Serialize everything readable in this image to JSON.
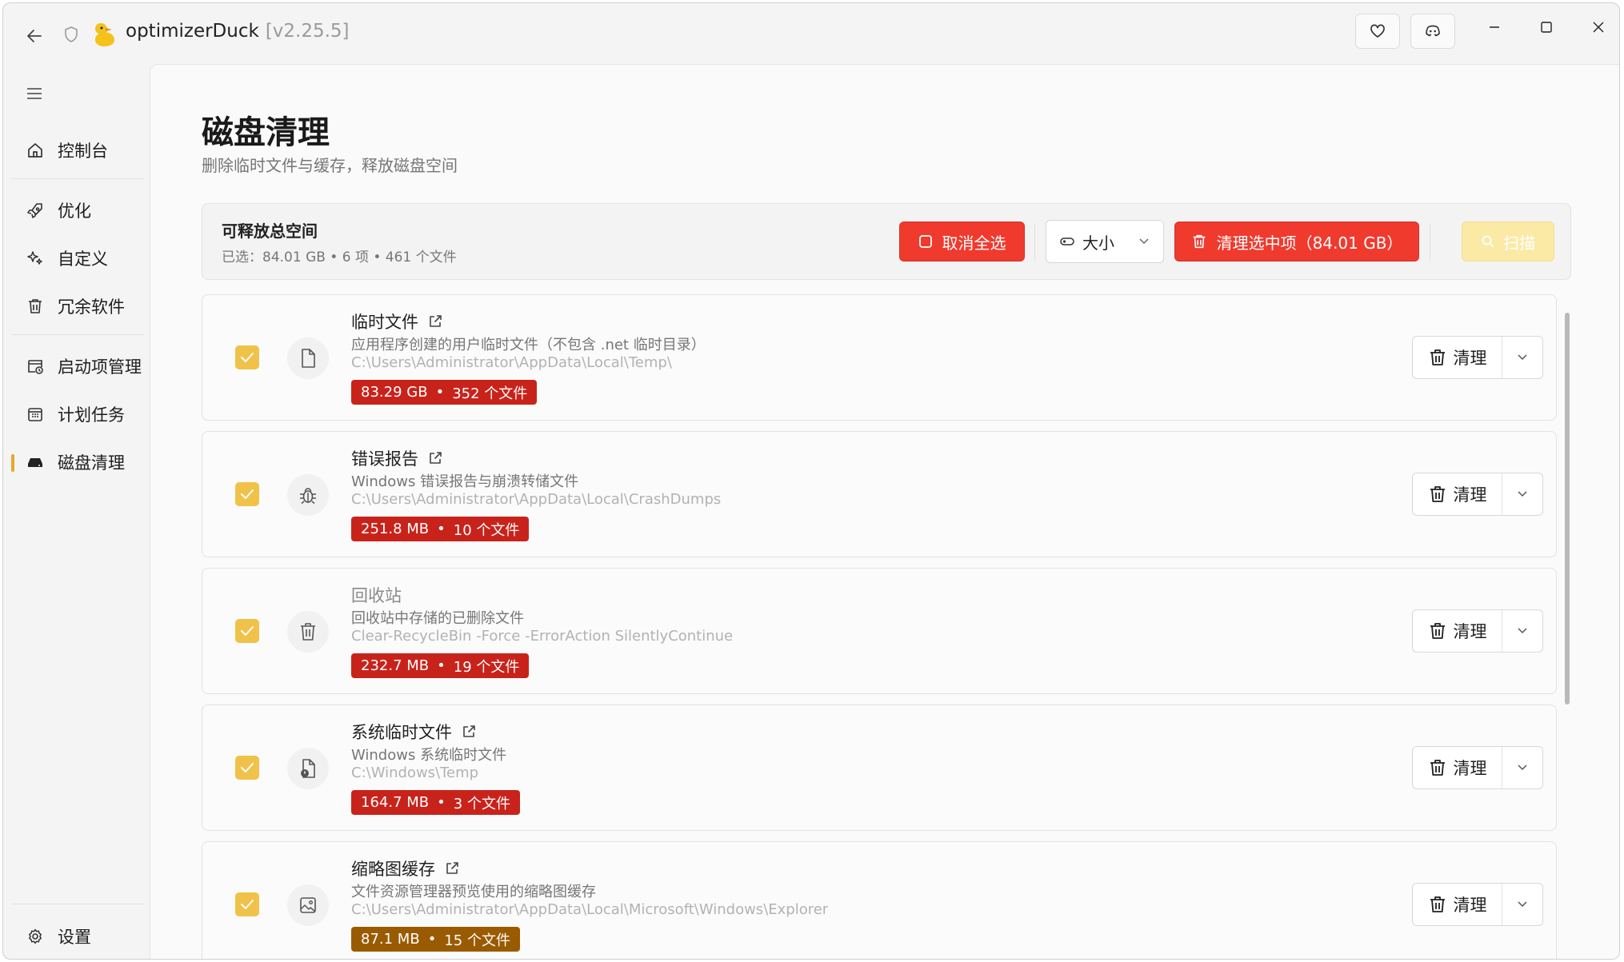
{
  "app": {
    "name": "optimizerDuck",
    "version": "[v2.25.5]"
  },
  "titlebar_icons": {
    "back": "arrow-left-icon",
    "shield": "shield-icon",
    "logo": "duck-logo",
    "favorite": "heart-icon",
    "community": "discord-icon",
    "minimize": "minimize-icon",
    "maximize": "maximize-icon",
    "close": "close-icon"
  },
  "sidebar": {
    "items": [
      {
        "label": "控制台",
        "icon": "home-icon"
      },
      {
        "label": "优化",
        "icon": "rocket-icon"
      },
      {
        "label": "自定义",
        "icon": "sparkle-icon"
      },
      {
        "label": "冗余软件",
        "icon": "trash-icon"
      },
      {
        "label": "启动项管理",
        "icon": "startup-icon"
      },
      {
        "label": "计划任务",
        "icon": "calendar-icon"
      },
      {
        "label": "磁盘清理",
        "icon": "drive-icon",
        "active": true
      }
    ],
    "settings": {
      "label": "设置",
      "icon": "gear-icon"
    }
  },
  "page": {
    "title": "磁盘清理",
    "subtitle": "删除临时文件与缓存，释放磁盘空间"
  },
  "summary": {
    "title": "可释放总空间",
    "detail": "已选：84.01 GB • 6 项 • 461 个文件",
    "deselect_label": "取消全选",
    "sort_label": "大小",
    "clean_selected_label": "清理选中项（84.01 GB）",
    "scan_label": "扫描"
  },
  "items": [
    {
      "title": "临时文件",
      "desc": "应用程序创建的用户临时文件（不包含 .net 临时目录）",
      "path": "C:\\Users\\Administrator\\AppData\\Local\\Temp\\",
      "size": "83.29 GB",
      "files": "352 个文件",
      "icon": "file-icon",
      "external": true,
      "clean_label": "清理"
    },
    {
      "title": "错误报告",
      "desc": "Windows 错误报告与崩溃转储文件",
      "path": "C:\\Users\\Administrator\\AppData\\Local\\CrashDumps",
      "size": "251.8 MB",
      "files": "10 个文件",
      "icon": "bug-icon",
      "external": true,
      "clean_label": "清理"
    },
    {
      "title": "回收站",
      "desc": "回收站中存储的已删除文件",
      "path": "Clear-RecycleBin -Force -ErrorAction SilentlyContinue",
      "size": "232.7 MB",
      "files": "19 个文件",
      "icon": "recycle-bin-icon",
      "external": false,
      "clean_label": "清理"
    },
    {
      "title": "系统临时文件",
      "desc": "Windows 系统临时文件",
      "path": "C:\\Windows\\Temp",
      "size": "164.7 MB",
      "files": "3 个文件",
      "icon": "system-file-icon",
      "external": true,
      "clean_label": "清理"
    },
    {
      "title": "缩略图缓存",
      "desc": "文件资源管理器预览使用的缩略图缓存",
      "path": "C:\\Users\\Administrator\\AppData\\Local\\Microsoft\\Windows\\Explorer",
      "size": "87.1 MB",
      "files": "15 个文件",
      "icon": "image-icon",
      "external": true,
      "clean_label": "清理"
    }
  ],
  "colors": {
    "accent": "#f0c24a",
    "danger": "#f03a2e",
    "badge_red": "#c8231b",
    "badge_amber": "#9a5a00"
  }
}
